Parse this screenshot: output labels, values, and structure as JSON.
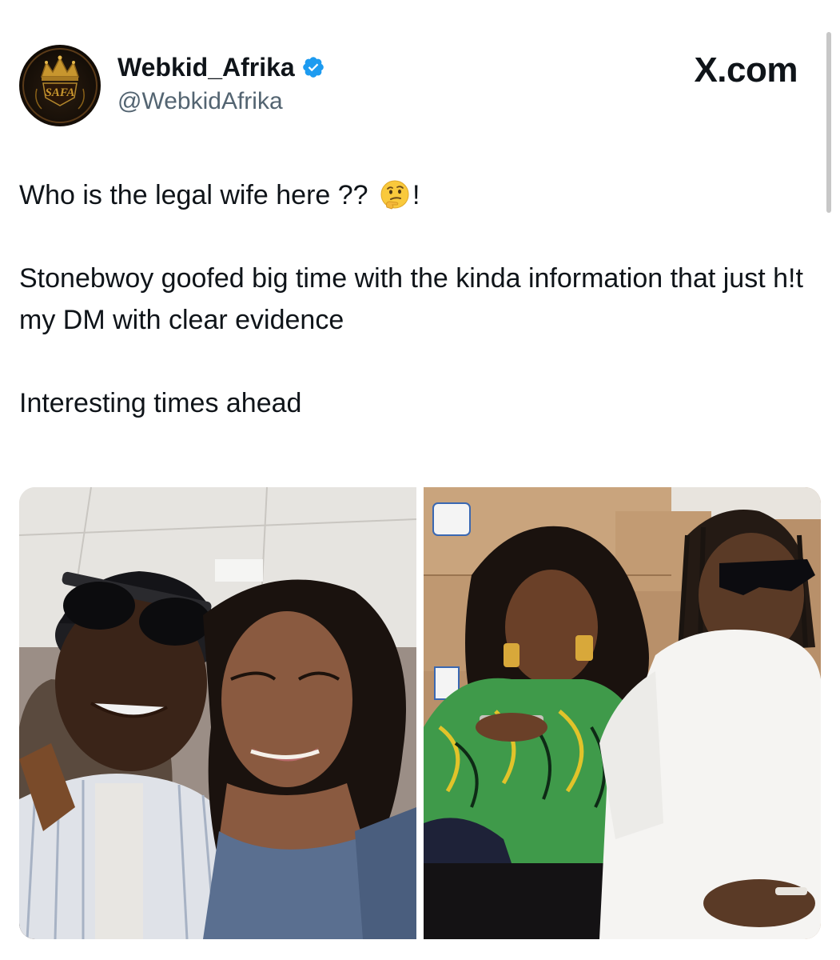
{
  "author": {
    "display_name": "Webkid_Afrika",
    "handle": "@WebkidAfrika",
    "verified": true,
    "avatar_icon": "crown-logo",
    "avatar_logo_text": "SAFA"
  },
  "brand": {
    "watermark": "X.com"
  },
  "tweet": {
    "line1_text": "Who is the legal wife here ??",
    "line1_emoji": "thinking-face",
    "line1_suffix": "!",
    "line2": "Stonebwoy goofed big time with the kinda information that just h!t my DM with clear evidence",
    "line3": "Interesting times ahead"
  },
  "media": {
    "left_photo": "selfie-man-cap-sunglasses-and-woman",
    "right_photo": "woman-green-dress-with-phone-and-man-white-tshirt"
  },
  "colors": {
    "verified_blue": "#1d9bf0",
    "text_primary": "#0f1419",
    "text_secondary": "#536471"
  }
}
